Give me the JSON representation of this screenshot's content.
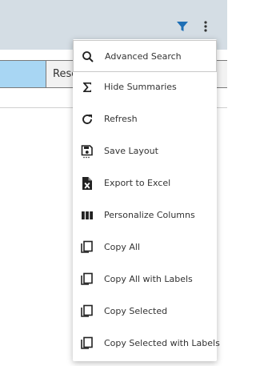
{
  "header": {
    "column_label": "Resc"
  },
  "toolbar": {
    "filter_icon": "filter-icon",
    "more_icon": "more-vertical-icon",
    "filter_color": "#1e6fb5"
  },
  "menu": {
    "items": [
      {
        "label": "Advanced Search",
        "icon": "search-icon"
      },
      {
        "label": "Hide Summaries",
        "icon": "sigma-icon"
      },
      {
        "label": "Refresh",
        "icon": "refresh-icon"
      },
      {
        "label": "Save Layout",
        "icon": "save-icon"
      },
      {
        "label": "Export to Excel",
        "icon": "excel-icon"
      },
      {
        "label": "Personalize Columns",
        "icon": "columns-icon"
      },
      {
        "label": "Copy All",
        "icon": "copy-icon"
      },
      {
        "label": "Copy All with Labels",
        "icon": "copy-icon"
      },
      {
        "label": "Copy Selected",
        "icon": "copy-icon"
      },
      {
        "label": "Copy Selected with Labels",
        "icon": "copy-icon"
      }
    ]
  }
}
